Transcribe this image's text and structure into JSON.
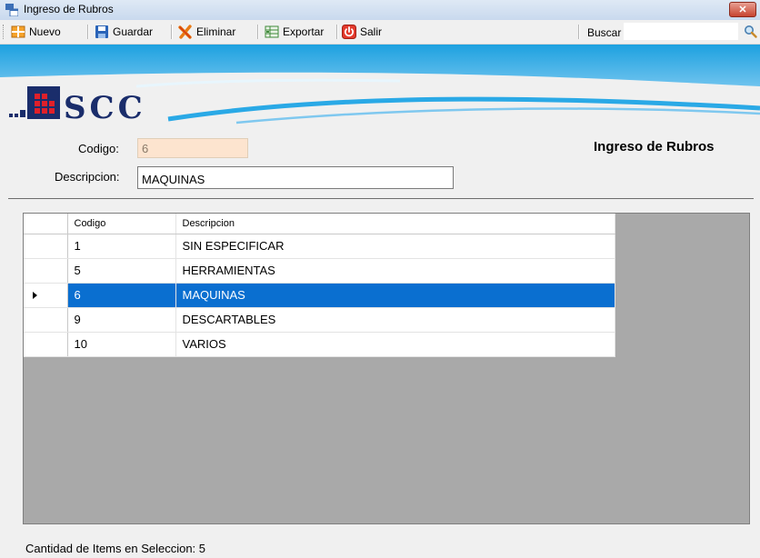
{
  "window": {
    "title": "Ingreso de Rubros",
    "close_glyph": "✕"
  },
  "toolbar": {
    "nuevo": "Nuevo",
    "guardar": "Guardar",
    "eliminar": "Eliminar",
    "exportar": "Exportar",
    "salir": "Salir",
    "buscar_label": "Buscar",
    "buscar_value": ""
  },
  "banner": {
    "logo_text": "SCC"
  },
  "form": {
    "codigo_label": "Codigo:",
    "codigo_value": "6",
    "descripcion_label": "Descripcion:",
    "descripcion_value": "MAQUINAS",
    "title": "Ingreso de Rubros"
  },
  "grid": {
    "columns": [
      "Codigo",
      "Descripcion"
    ],
    "rows": [
      {
        "codigo": "1",
        "descripcion": "SIN ESPECIFICAR"
      },
      {
        "codigo": "5",
        "descripcion": "HERRAMIENTAS"
      },
      {
        "codigo": "6",
        "descripcion": "MAQUINAS"
      },
      {
        "codigo": "9",
        "descripcion": "DESCARTABLES"
      },
      {
        "codigo": "10",
        "descripcion": "VARIOS"
      }
    ],
    "selected_index": 2
  },
  "status": {
    "text": "Cantidad de Items en Seleccion: 5"
  },
  "colors": {
    "selection": "#0a6fd0",
    "banner_blue": "#1da1e0",
    "logo_red": "#e0202a",
    "logo_navy": "#1a2d6b"
  }
}
